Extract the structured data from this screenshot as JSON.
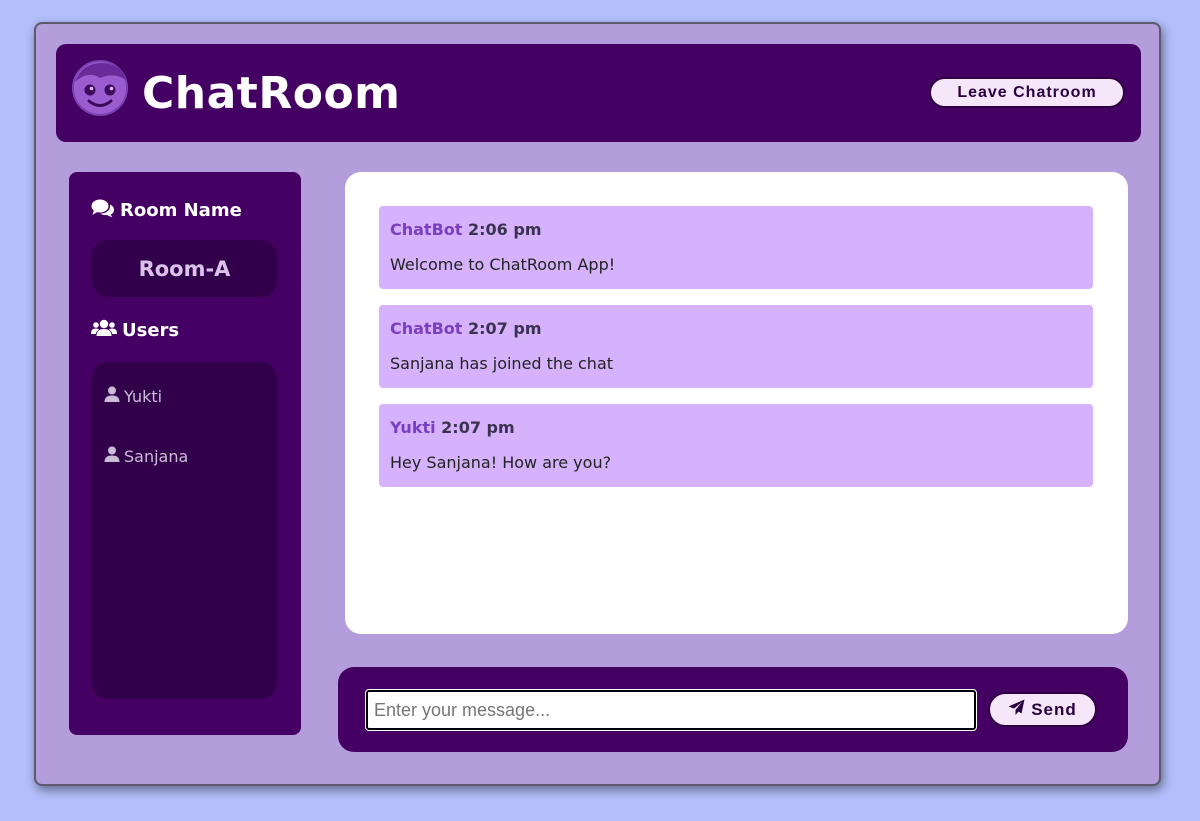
{
  "header": {
    "title": "ChatRoom",
    "leave_label": "Leave Chatroom",
    "logo_icon": "smiley-face-icon"
  },
  "sidebar": {
    "room_heading": "Room Name",
    "room_name": "Room-A",
    "users_heading": "Users",
    "users": [
      {
        "name": "Yukti"
      },
      {
        "name": "Sanjana"
      }
    ]
  },
  "messages": [
    {
      "author": "ChatBot",
      "time": "2:06 pm",
      "text": "Welcome to ChatRoom App!"
    },
    {
      "author": "ChatBot",
      "time": "2:07 pm",
      "text": "Sanjana has joined the chat"
    },
    {
      "author": "Yukti",
      "time": "2:07 pm",
      "text": "Hey Sanjana! How are you?"
    }
  ],
  "composer": {
    "placeholder": "Enter your message...",
    "value": "",
    "send_label": "Send"
  },
  "colors": {
    "page_bg": "#b3befa",
    "app_bg": "#b39ddb",
    "primary": "#450063",
    "message_bg": "#d6b2fc",
    "author_color": "#7a3fc0"
  }
}
